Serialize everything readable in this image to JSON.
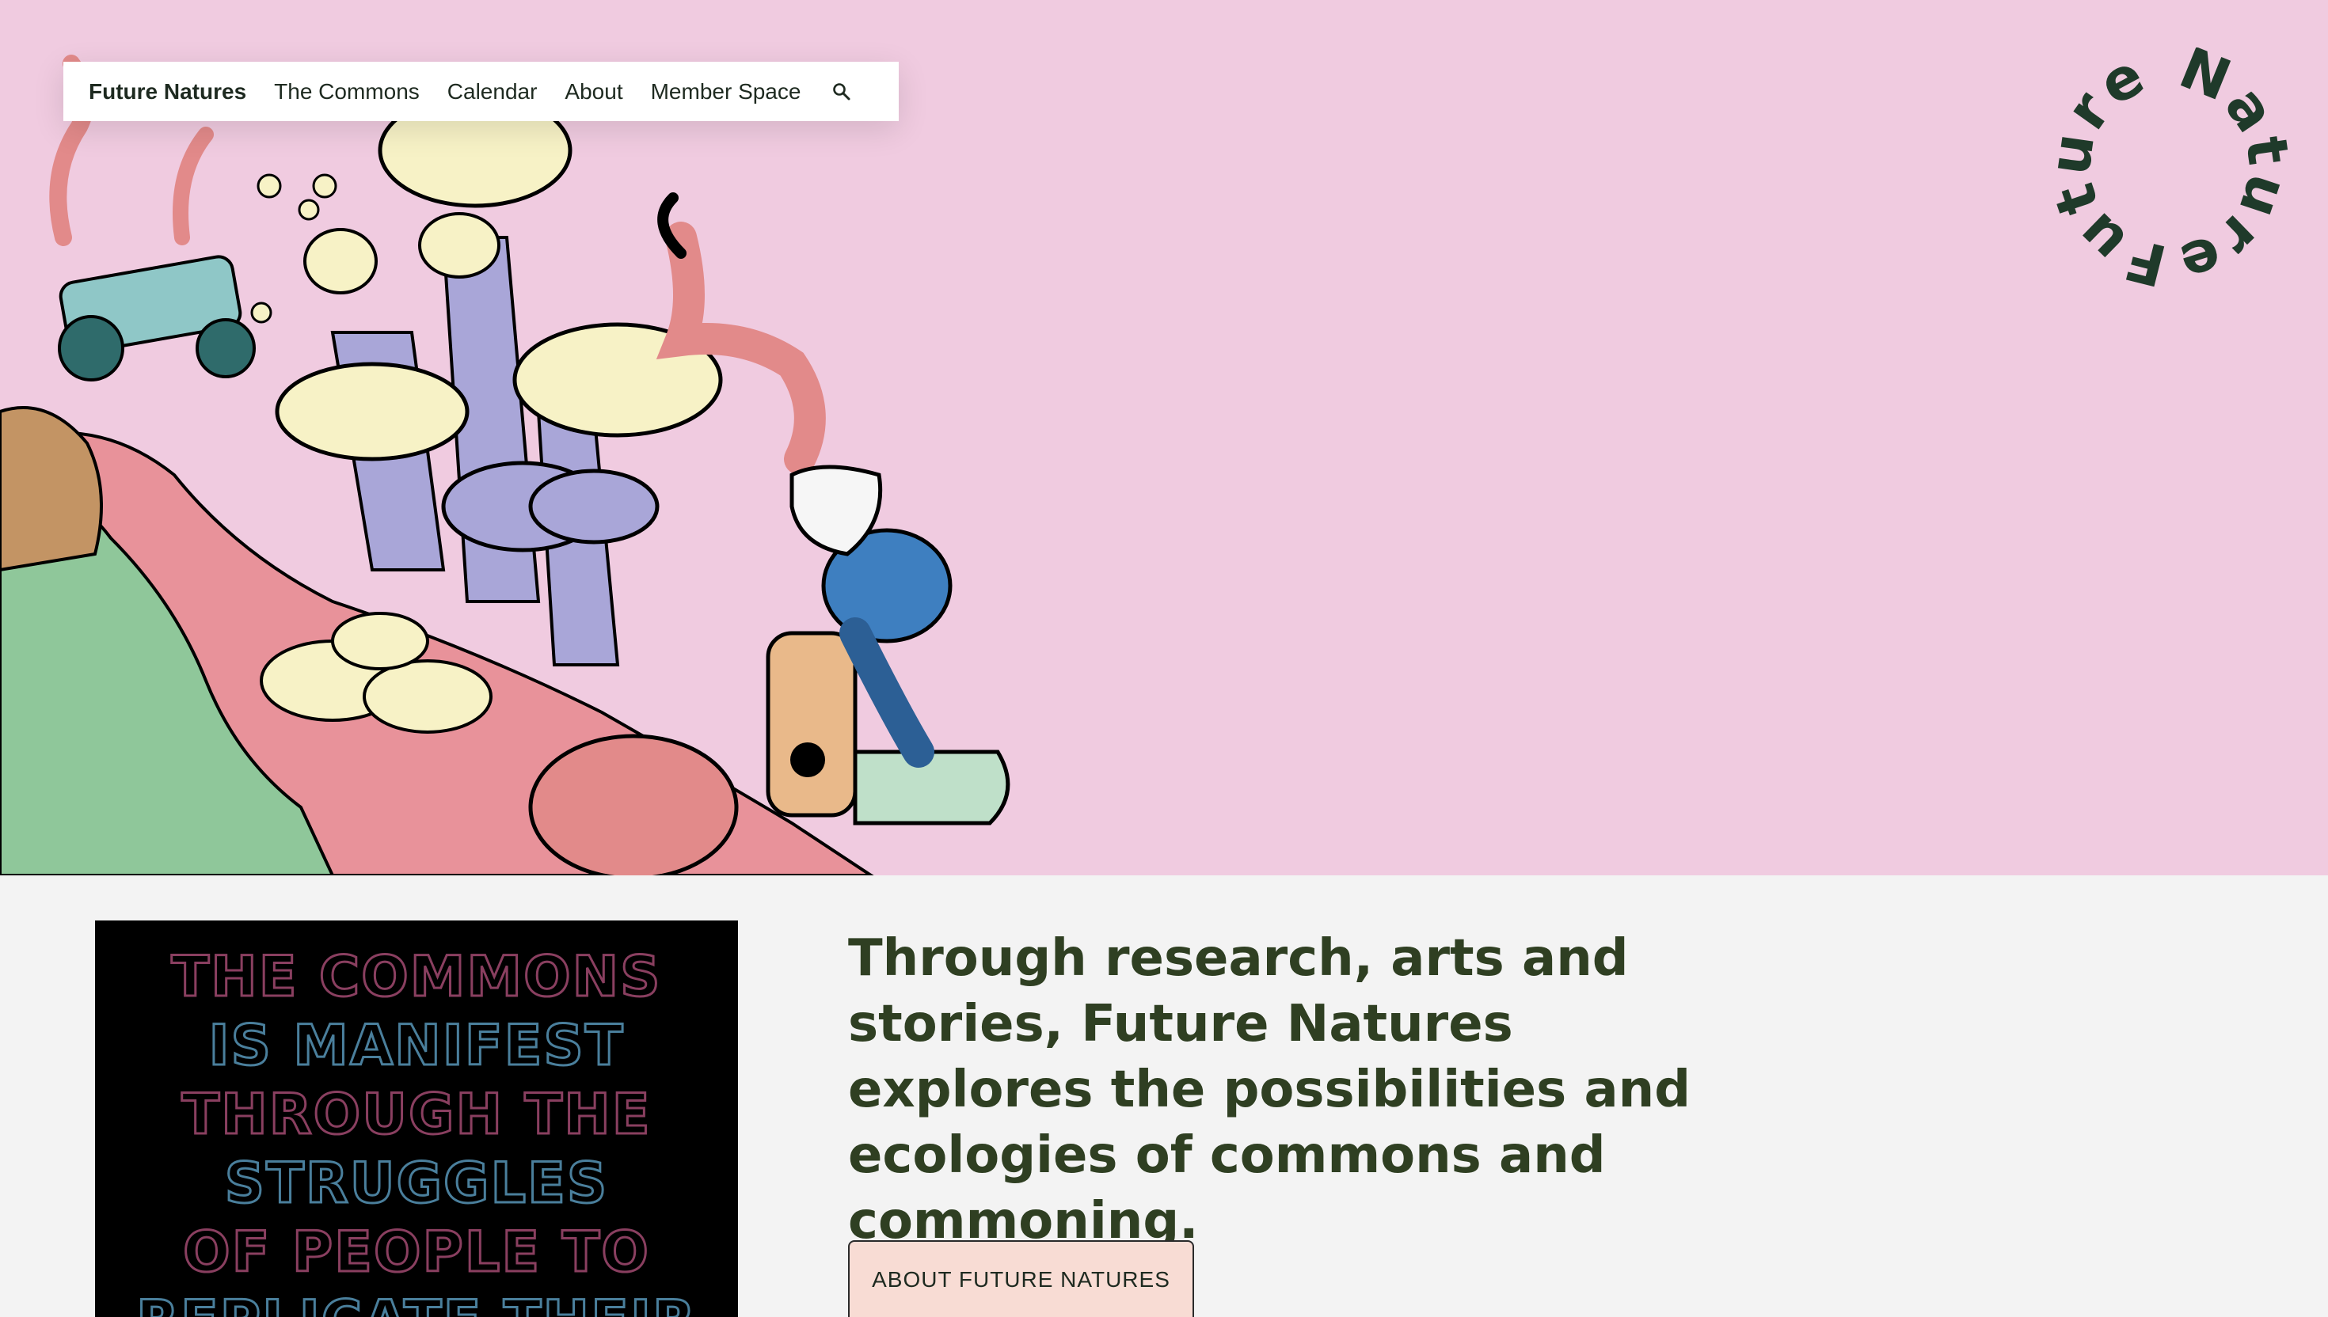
{
  "nav": {
    "brand": "Future Natures",
    "items": [
      "The Commons",
      "Calendar",
      "About",
      "Member Space"
    ],
    "search_icon": "search-icon"
  },
  "logo": {
    "text": "Future Natures"
  },
  "poster": {
    "lines": [
      "THE COMMONS",
      "IS MANIFEST",
      "THROUGH THE",
      "STRUGGLES",
      "OF PEOPLE TO",
      "REPLICATE THEIR"
    ]
  },
  "intro": {
    "headline": "Through research, arts and stories, Future Natures explores the possibilities and ecologies of commons and commoning.",
    "button_label": "ABOUT FUTURE NATURES"
  },
  "colors": {
    "hero_bg": "#f0cbe0",
    "page_bg": "#f3f3f3",
    "headline": "#2f3f22",
    "button_bg": "#f8dcd4",
    "logo": "#1f3a2a"
  }
}
